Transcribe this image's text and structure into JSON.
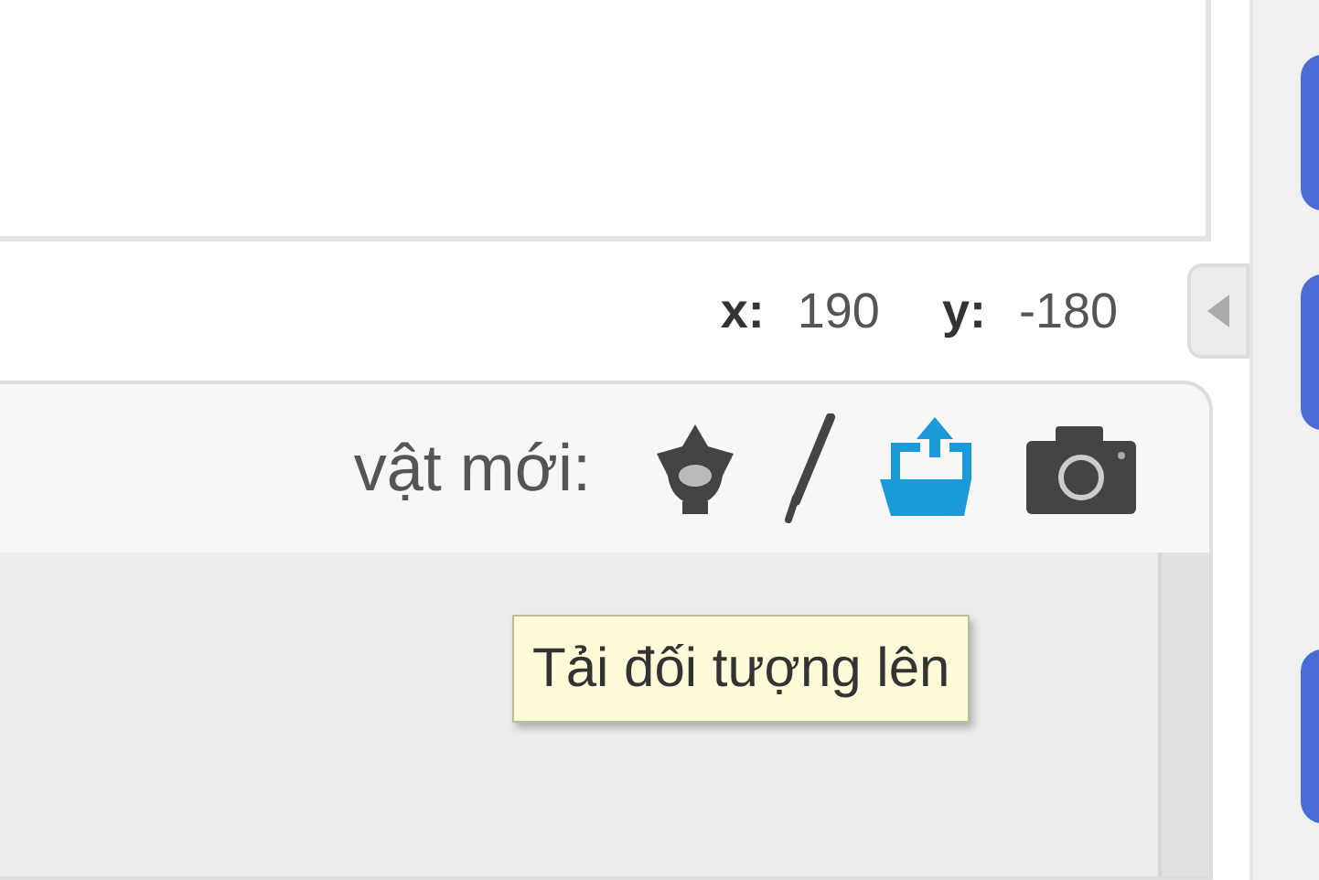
{
  "stage_info": {
    "x_label": "x:",
    "x_value": "190",
    "y_label": "y:",
    "y_value": "-180"
  },
  "sprite_pane": {
    "new_sprite_label": "vật mới:",
    "tool_buttons": [
      {
        "kind": "library",
        "hovered": false
      },
      {
        "kind": "paint",
        "hovered": false
      },
      {
        "kind": "upload",
        "hovered": true
      },
      {
        "kind": "camera",
        "hovered": false
      }
    ]
  },
  "tooltip": {
    "text": "Tải đối tượng lên"
  }
}
